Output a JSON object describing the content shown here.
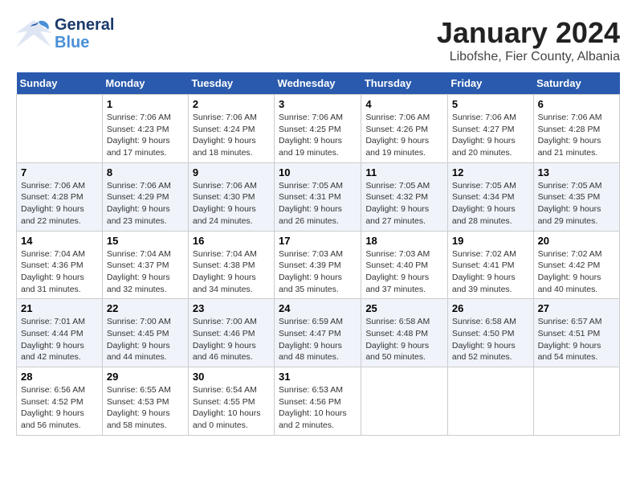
{
  "header": {
    "logo_line1": "General",
    "logo_line2": "Blue",
    "title": "January 2024",
    "subtitle": "Libofshe, Fier County, Albania"
  },
  "calendar": {
    "weekdays": [
      "Sunday",
      "Monday",
      "Tuesday",
      "Wednesday",
      "Thursday",
      "Friday",
      "Saturday"
    ],
    "weeks": [
      [
        {
          "day": "",
          "info": ""
        },
        {
          "day": "1",
          "info": "Sunrise: 7:06 AM\nSunset: 4:23 PM\nDaylight: 9 hours\nand 17 minutes."
        },
        {
          "day": "2",
          "info": "Sunrise: 7:06 AM\nSunset: 4:24 PM\nDaylight: 9 hours\nand 18 minutes."
        },
        {
          "day": "3",
          "info": "Sunrise: 7:06 AM\nSunset: 4:25 PM\nDaylight: 9 hours\nand 19 minutes."
        },
        {
          "day": "4",
          "info": "Sunrise: 7:06 AM\nSunset: 4:26 PM\nDaylight: 9 hours\nand 19 minutes."
        },
        {
          "day": "5",
          "info": "Sunrise: 7:06 AM\nSunset: 4:27 PM\nDaylight: 9 hours\nand 20 minutes."
        },
        {
          "day": "6",
          "info": "Sunrise: 7:06 AM\nSunset: 4:28 PM\nDaylight: 9 hours\nand 21 minutes."
        }
      ],
      [
        {
          "day": "7",
          "info": ""
        },
        {
          "day": "8",
          "info": "Sunrise: 7:06 AM\nSunset: 4:28 PM\nDaylight: 9 hours\nand 22 minutes."
        },
        {
          "day": "9",
          "info": "Sunrise: 7:06 AM\nSunset: 4:29 PM\nDaylight: 9 hours\nand 23 minutes."
        },
        {
          "day": "10",
          "info": "Sunrise: 7:06 AM\nSunset: 4:30 PM\nDaylight: 9 hours\nand 24 minutes."
        },
        {
          "day": "11",
          "info": "Sunrise: 7:05 AM\nSunset: 4:31 PM\nDaylight: 9 hours\nand 26 minutes."
        },
        {
          "day": "12",
          "info": "Sunrise: 7:05 AM\nSunset: 4:32 PM\nDaylight: 9 hours\nand 27 minutes."
        },
        {
          "day": "13",
          "info": "Sunrise: 7:05 AM\nSunset: 4:34 PM\nDaylight: 9 hours\nand 28 minutes."
        },
        {
          "day": "",
          "info": "Sunrise: 7:05 AM\nSunset: 4:35 PM\nDaylight: 9 hours\nand 29 minutes."
        }
      ],
      [
        {
          "day": "14",
          "info": ""
        },
        {
          "day": "15",
          "info": "Sunrise: 7:04 AM\nSunset: 4:36 PM\nDaylight: 9 hours\nand 31 minutes."
        },
        {
          "day": "16",
          "info": "Sunrise: 7:04 AM\nSunset: 4:37 PM\nDaylight: 9 hours\nand 32 minutes."
        },
        {
          "day": "17",
          "info": "Sunrise: 7:04 AM\nSunset: 4:38 PM\nDaylight: 9 hours\nand 34 minutes."
        },
        {
          "day": "18",
          "info": "Sunrise: 7:03 AM\nSunset: 4:39 PM\nDaylight: 9 hours\nand 35 minutes."
        },
        {
          "day": "19",
          "info": "Sunrise: 7:03 AM\nSunset: 4:40 PM\nDaylight: 9 hours\nand 37 minutes."
        },
        {
          "day": "20",
          "info": "Sunrise: 7:02 AM\nSunset: 4:41 PM\nDaylight: 9 hours\nand 39 minutes."
        },
        {
          "day": "",
          "info": "Sunrise: 7:02 AM\nSunset: 4:42 PM\nDaylight: 9 hours\nand 40 minutes."
        }
      ],
      [
        {
          "day": "21",
          "info": ""
        },
        {
          "day": "22",
          "info": "Sunrise: 7:01 AM\nSunset: 4:44 PM\nDaylight: 9 hours\nand 42 minutes."
        },
        {
          "day": "23",
          "info": "Sunrise: 7:00 AM\nSunset: 4:45 PM\nDaylight: 9 hours\nand 44 minutes."
        },
        {
          "day": "24",
          "info": "Sunrise: 7:00 AM\nSunset: 4:46 PM\nDaylight: 9 hours\nand 46 minutes."
        },
        {
          "day": "25",
          "info": "Sunrise: 6:59 AM\nSunset: 4:47 PM\nDaylight: 9 hours\nand 48 minutes."
        },
        {
          "day": "26",
          "info": "Sunrise: 6:58 AM\nSunset: 4:48 PM\nDaylight: 9 hours\nand 50 minutes."
        },
        {
          "day": "27",
          "info": "Sunrise: 6:58 AM\nSunset: 4:50 PM\nDaylight: 9 hours\nand 52 minutes."
        },
        {
          "day": "",
          "info": "Sunrise: 6:57 AM\nSunset: 4:51 PM\nDaylight: 9 hours\nand 54 minutes."
        }
      ],
      [
        {
          "day": "28",
          "info": ""
        },
        {
          "day": "29",
          "info": "Sunrise: 6:56 AM\nSunset: 4:52 PM\nDaylight: 9 hours\nand 56 minutes."
        },
        {
          "day": "30",
          "info": "Sunrise: 6:55 AM\nSunset: 4:53 PM\nDaylight: 9 hours\nand 58 minutes."
        },
        {
          "day": "31",
          "info": "Sunrise: 6:54 AM\nSunset: 4:55 PM\nDaylight: 10 hours\nand 0 minutes."
        },
        {
          "day": "",
          "info": "Sunrise: 6:53 AM\nSunset: 4:56 PM\nDaylight: 10 hours\nand 2 minutes."
        },
        {
          "day": "",
          "info": ""
        },
        {
          "day": "",
          "info": ""
        },
        {
          "day": "",
          "info": ""
        }
      ]
    ]
  }
}
